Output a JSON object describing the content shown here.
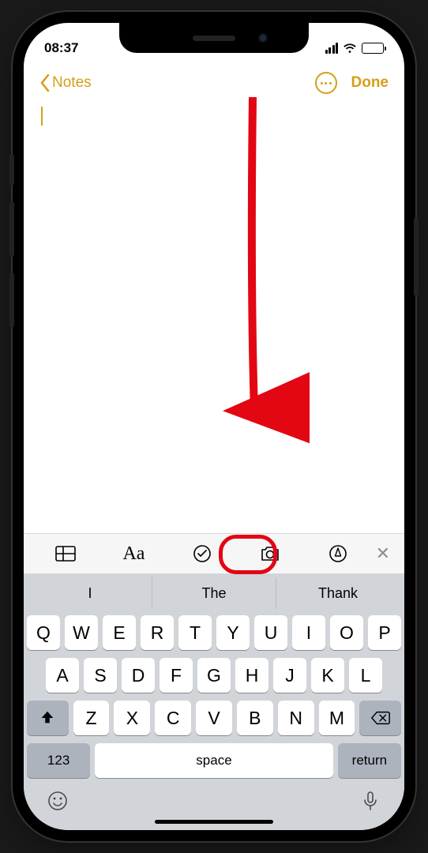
{
  "status": {
    "time": "08:37"
  },
  "nav": {
    "back_label": "Notes",
    "done_label": "Done"
  },
  "format_bar": {
    "icons": [
      "table-icon",
      "text-style-icon",
      "checklist-icon",
      "camera-icon",
      "markup-icon"
    ],
    "highlighted": "camera-icon"
  },
  "suggestions": [
    "I",
    "The",
    "Thank"
  ],
  "keyboard": {
    "row1": [
      "Q",
      "W",
      "E",
      "R",
      "T",
      "Y",
      "U",
      "I",
      "O",
      "P"
    ],
    "row2": [
      "A",
      "S",
      "D",
      "F",
      "G",
      "H",
      "J",
      "K",
      "L"
    ],
    "row3": [
      "Z",
      "X",
      "C",
      "V",
      "B",
      "N",
      "M"
    ],
    "numbers_label": "123",
    "space_label": "space",
    "return_label": "return"
  },
  "annotation": {
    "target": "camera-icon"
  }
}
